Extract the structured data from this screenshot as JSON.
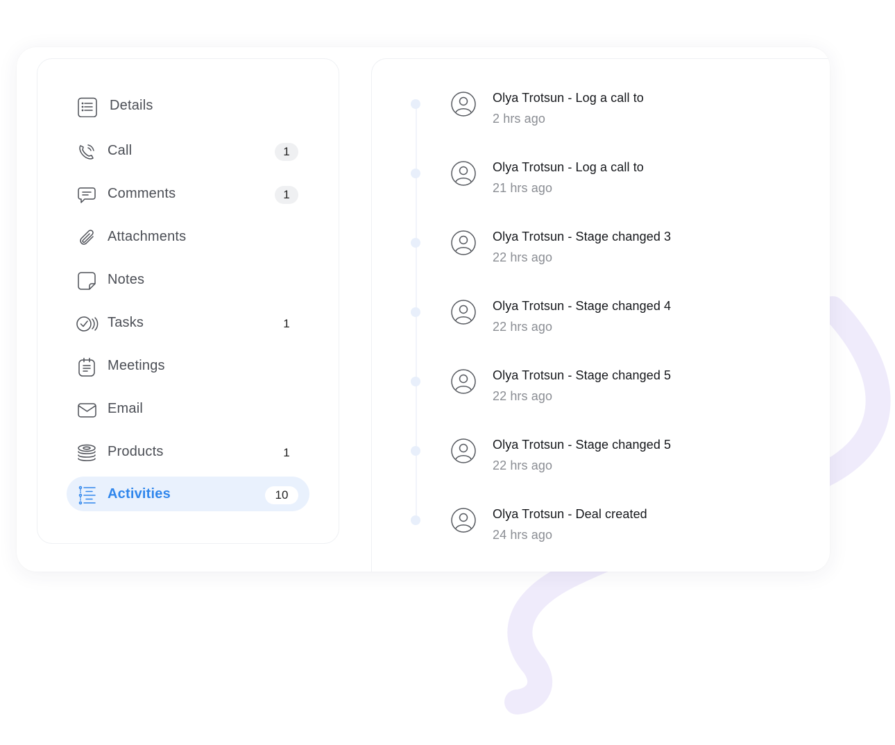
{
  "colors": {
    "accent": "#2f86ec",
    "active_bg": "#e9f1fd",
    "decor_stroke": "#eeebfb",
    "text_primary": "#14161a",
    "text_muted": "#8a8d93"
  },
  "sidebar": {
    "items": [
      {
        "label": "Details",
        "icon": "details-list-icon",
        "badge": ""
      },
      {
        "label": "Call",
        "icon": "phone-call-icon",
        "badge": "1"
      },
      {
        "label": "Comments",
        "icon": "comment-icon",
        "badge": "1"
      },
      {
        "label": "Attachments",
        "icon": "paperclip-icon",
        "badge": ""
      },
      {
        "label": "Notes",
        "icon": "note-icon",
        "badge": ""
      },
      {
        "label": "Tasks",
        "icon": "task-check-icon",
        "badge": "1"
      },
      {
        "label": "Meetings",
        "icon": "meeting-calendar-icon",
        "badge": ""
      },
      {
        "label": "Email",
        "icon": "envelope-icon",
        "badge": ""
      },
      {
        "label": "Products",
        "icon": "products-stack-icon",
        "badge": "1"
      },
      {
        "label": "Activities",
        "icon": "activities-list-icon",
        "badge": "10",
        "active": true
      }
    ]
  },
  "feed": {
    "items": [
      {
        "title": "Olya Trotsun - Log a call to",
        "time": "2 hrs ago"
      },
      {
        "title": "Olya Trotsun - Log a call to",
        "time": "21 hrs ago"
      },
      {
        "title": "Olya Trotsun - Stage changed 3",
        "time": "22 hrs ago"
      },
      {
        "title": "Olya Trotsun - Stage changed 4",
        "time": "22 hrs ago"
      },
      {
        "title": "Olya Trotsun - Stage changed 5",
        "time": "22 hrs ago"
      },
      {
        "title": "Olya Trotsun - Stage changed 5",
        "time": "22 hrs ago"
      },
      {
        "title": "Olya Trotsun - Deal created",
        "time": "24 hrs ago"
      }
    ]
  }
}
